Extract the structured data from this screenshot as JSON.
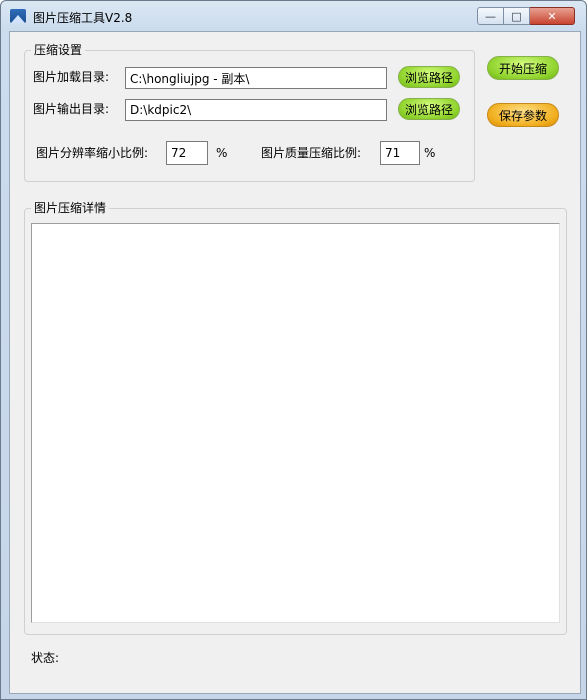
{
  "window": {
    "title": "图片压缩工具V2.8",
    "controls": {
      "minimize": "—",
      "maximize": "□",
      "close": "✕"
    }
  },
  "settings_group": {
    "legend": "压缩设置",
    "load_dir_label": "图片加载目录:",
    "load_dir_value": "C:\\hongliujpg - 副本\\",
    "output_dir_label": "图片输出目录:",
    "output_dir_value": "D:\\kdpic2\\",
    "browse_label": "浏览路径",
    "resolution_label": "图片分辨率缩小比例:",
    "resolution_value": "72",
    "quality_label": "图片质量压缩比例:",
    "quality_value": "71",
    "percent_sign": "%"
  },
  "actions": {
    "start_label": "开始压缩",
    "save_label": "保存参数"
  },
  "details_group": {
    "legend": "图片压缩详情"
  },
  "status": {
    "label": "状态:"
  },
  "colors": {
    "title_gradient": "#cbdcee",
    "client_background": "#f0f0f0",
    "green_button": "#8ed22b",
    "orange_button": "#f0ad1c",
    "close_button": "#c8442f"
  }
}
